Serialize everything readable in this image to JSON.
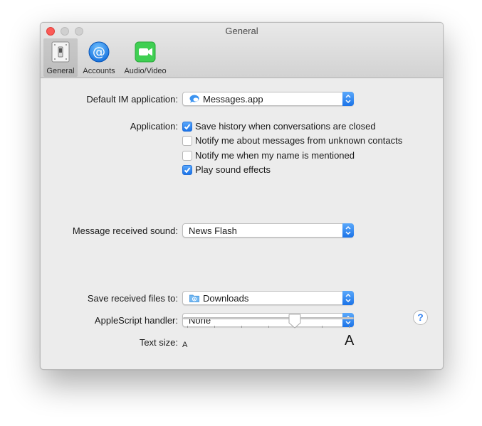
{
  "window": {
    "title": "General"
  },
  "toolbar": {
    "tabs": [
      {
        "label": "General",
        "icon": "switch-icon",
        "selected": true
      },
      {
        "label": "Accounts",
        "icon": "at-sign-icon",
        "selected": false
      },
      {
        "label": "Audio/Video",
        "icon": "video-camera-icon",
        "selected": false
      }
    ]
  },
  "settings": {
    "default_im": {
      "label": "Default IM application:",
      "value": "Messages.app",
      "icon": "messages-app-icon"
    },
    "application": {
      "label": "Application:",
      "options": [
        {
          "label": "Save history when conversations are closed",
          "checked": true
        },
        {
          "label": "Notify me about messages from unknown contacts",
          "checked": false
        },
        {
          "label": "Notify me when my name is mentioned",
          "checked": false
        },
        {
          "label": "Play sound effects",
          "checked": true
        }
      ]
    },
    "sound": {
      "label": "Message received sound:",
      "value": "News Flash"
    },
    "save_files": {
      "label": "Save received files to:",
      "value": "Downloads",
      "icon": "downloads-folder-icon"
    },
    "applescript": {
      "label": "AppleScript handler:",
      "value": "None"
    },
    "text_size": {
      "label": "Text size:",
      "small_glyph": "A",
      "large_glyph": "A",
      "level": 0.62,
      "ticks": 7
    }
  },
  "help": {
    "glyph": "?"
  },
  "colors": {
    "accent": "#1b73e8",
    "close": "#fc5b57",
    "window_bg": "#ececec"
  }
}
